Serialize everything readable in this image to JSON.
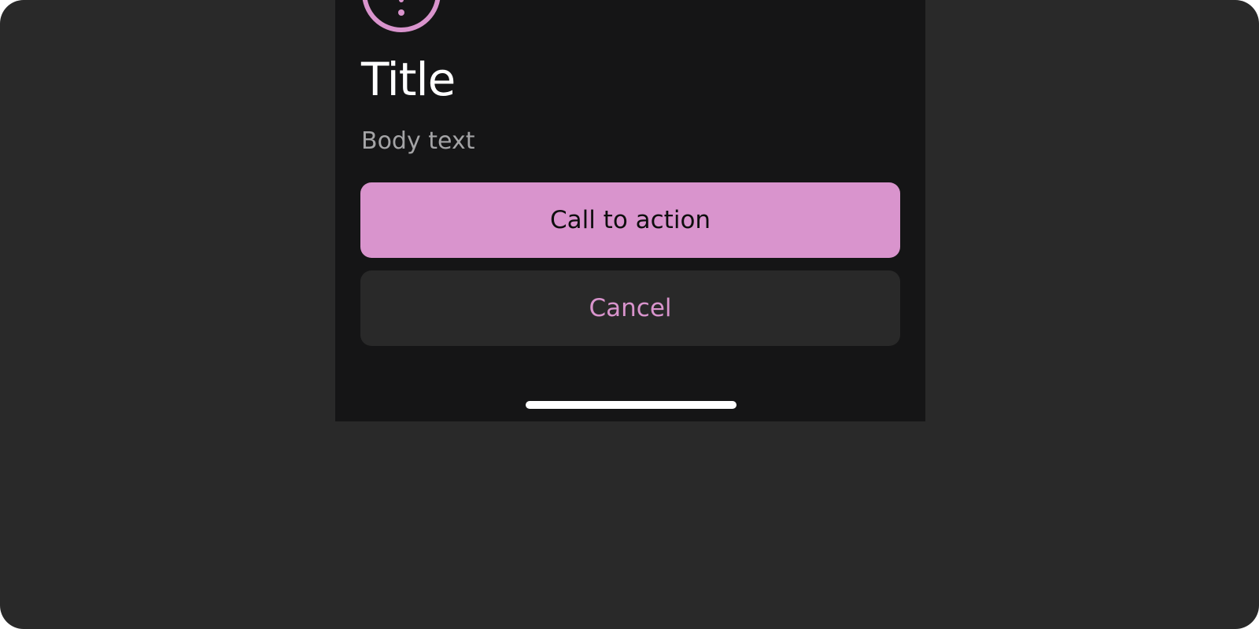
{
  "dialog": {
    "icon": "alert-circle-icon",
    "title": "Title",
    "body": "Body text",
    "primary_label": "Call to action",
    "secondary_label": "Cancel"
  },
  "colors": {
    "background": "#292929",
    "sheet": "#151516",
    "accent": "#d994cd",
    "title": "#ffffff",
    "body": "#a4a4a6"
  }
}
